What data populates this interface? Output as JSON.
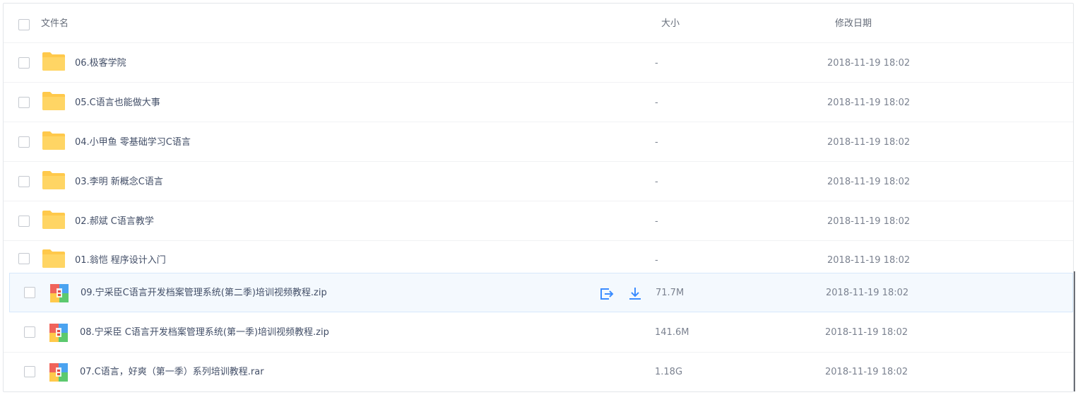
{
  "header": {
    "name_label": "文件名",
    "size_label": "大小",
    "date_label": "修改日期"
  },
  "folders": [
    {
      "name": "06.极客学院",
      "size": "-",
      "date": "2018-11-19 18:02"
    },
    {
      "name": "05.C语言也能做大事",
      "size": "-",
      "date": "2018-11-19 18:02"
    },
    {
      "name": "04.小甲鱼 零基础学习C语言",
      "size": "-",
      "date": "2018-11-19 18:02"
    },
    {
      "name": "03.李明 新概念C语言",
      "size": "-",
      "date": "2018-11-19 18:02"
    },
    {
      "name": "02.郝斌 C语言教学",
      "size": "-",
      "date": "2018-11-19 18:02"
    },
    {
      "name": "01.翁恺 程序设计入门",
      "size": "-",
      "date": "2018-11-19 18:02"
    }
  ],
  "files": [
    {
      "name": "09.宁采臣C语言开发档案管理系统(第二季)培训视频教程.zip",
      "size": "71.7M",
      "date": "2018-11-19 18:02"
    },
    {
      "name": "08.宁采臣 C语言开发档案管理系统(第一季)培训视频教程.zip",
      "size": "141.6M",
      "date": "2018-11-19 18:02"
    },
    {
      "name": "07.C语言，好爽（第一季）系列培训教程.rar",
      "size": "1.18G",
      "date": "2018-11-19 18:02"
    }
  ],
  "colors": {
    "folder": "#ffc94b",
    "accent": "#3b8cff",
    "hover_bg": "#f4f9fe"
  },
  "icons": {
    "folder": "folder-icon",
    "archive": "archive-icon",
    "share": "share-icon",
    "download": "download-icon"
  }
}
